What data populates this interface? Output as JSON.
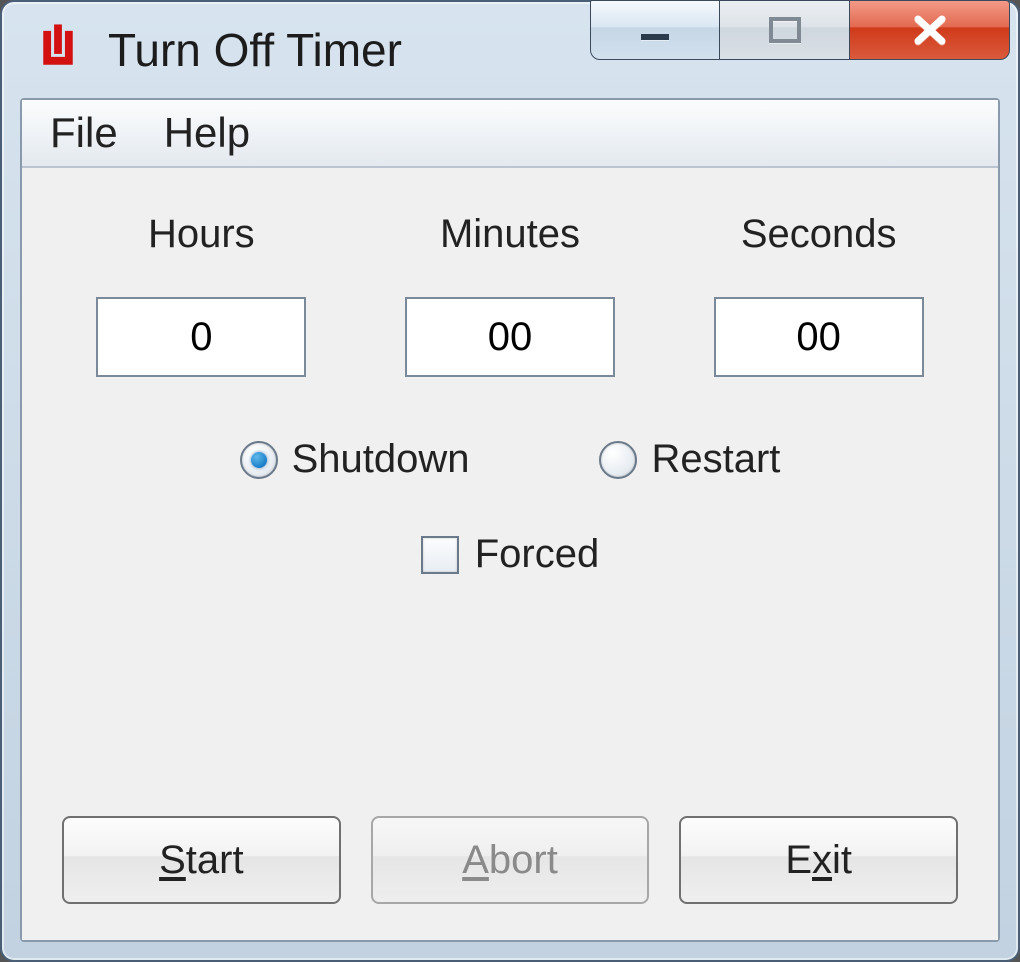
{
  "window": {
    "title": "Turn Off Timer"
  },
  "menubar": {
    "file": "File",
    "help": "Help"
  },
  "timer": {
    "hours_label": "Hours",
    "minutes_label": "Minutes",
    "seconds_label": "Seconds",
    "hours_value": "0",
    "minutes_value": "00",
    "seconds_value": "00"
  },
  "options": {
    "shutdown_label": "Shutdown",
    "restart_label": "Restart",
    "forced_label": "Forced",
    "selected": "shutdown",
    "forced_checked": false
  },
  "buttons": {
    "start": "Start",
    "abort": "Abort",
    "exit": "Exit"
  }
}
